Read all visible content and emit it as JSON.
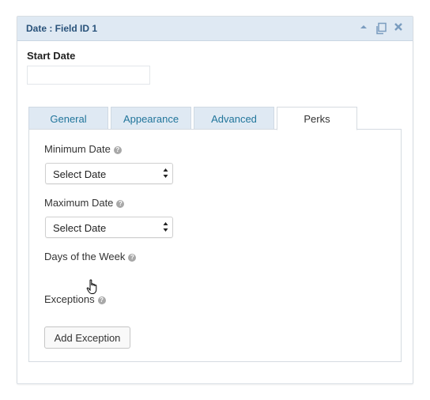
{
  "panel": {
    "title": "Date : Field ID 1",
    "icons": [
      "collapse-arrow-icon",
      "duplicate-icon",
      "close-icon"
    ]
  },
  "field": {
    "label": "Start Date",
    "input_value": ""
  },
  "tabs": [
    {
      "label": "General",
      "active": false
    },
    {
      "label": "Appearance",
      "active": false
    },
    {
      "label": "Advanced",
      "active": false
    },
    {
      "label": "Perks",
      "active": true
    }
  ],
  "perks": {
    "minimum_date": {
      "label": "Minimum Date",
      "selected": "Select Date"
    },
    "maximum_date": {
      "label": "Maximum Date",
      "selected": "Select Date"
    },
    "days_of_week": {
      "label": "Days of the Week"
    },
    "exceptions": {
      "label": "Exceptions",
      "button": "Add Exception"
    },
    "help_glyph": "?"
  },
  "colors": {
    "header_bg": "#dfe9f3",
    "title_color": "#29527a",
    "tab_link": "#21759b"
  }
}
